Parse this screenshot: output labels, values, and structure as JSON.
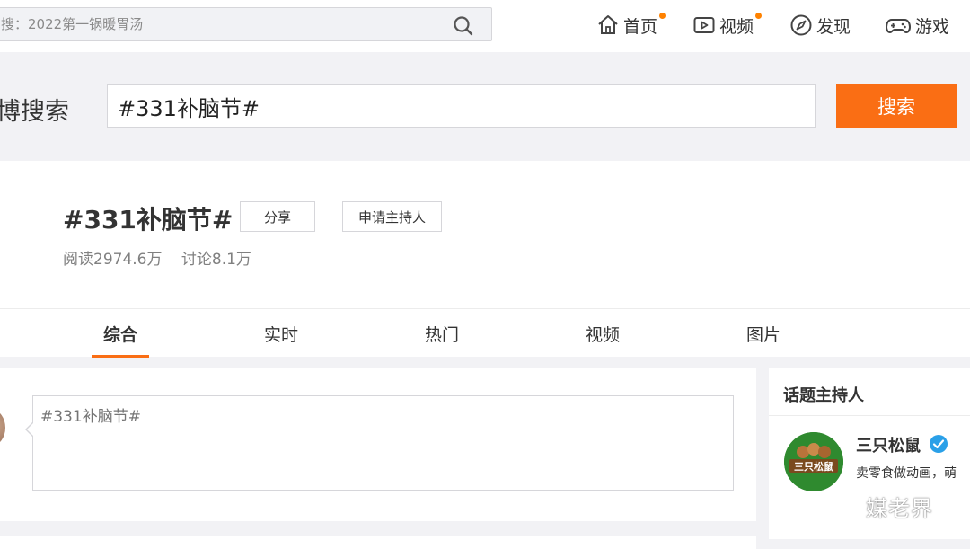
{
  "top_search": {
    "placeholder": "搜：2022第一锅暖胃汤"
  },
  "nav": [
    {
      "label": "首页",
      "icon": "home-icon",
      "has_dot": true
    },
    {
      "label": "视频",
      "icon": "video-icon",
      "has_dot": true
    },
    {
      "label": "发现",
      "icon": "compass-icon",
      "has_dot": false
    },
    {
      "label": "游戏",
      "icon": "gamepad-icon",
      "has_dot": false
    }
  ],
  "band": {
    "title": "博搜索",
    "query": "#331补脑节#",
    "search_button": "搜索"
  },
  "topic": {
    "title": "#331补脑节#",
    "share_label": "分享",
    "apply_host_label": "申请主持人",
    "reads": "阅读2974.6万",
    "discussions": "讨论8.1万"
  },
  "tabs": [
    {
      "label": "综合",
      "active": true
    },
    {
      "label": "实时",
      "active": false
    },
    {
      "label": "热门",
      "active": false
    },
    {
      "label": "视频",
      "active": false
    },
    {
      "label": "图片",
      "active": false
    }
  ],
  "composer": {
    "placeholder": "#331补脑节#"
  },
  "host": {
    "section_title": "话题主持人",
    "name": "三只松鼠",
    "avatar_text": "三只松鼠",
    "description": "卖零食做动画，萌"
  },
  "watermark": {
    "text": "媒老界"
  },
  "colors": {
    "accent": "#fa6e14",
    "nav_dot": "#ff8200",
    "verify": "#2aa0e8",
    "host_avatar_bg": "#2f8a2f"
  }
}
